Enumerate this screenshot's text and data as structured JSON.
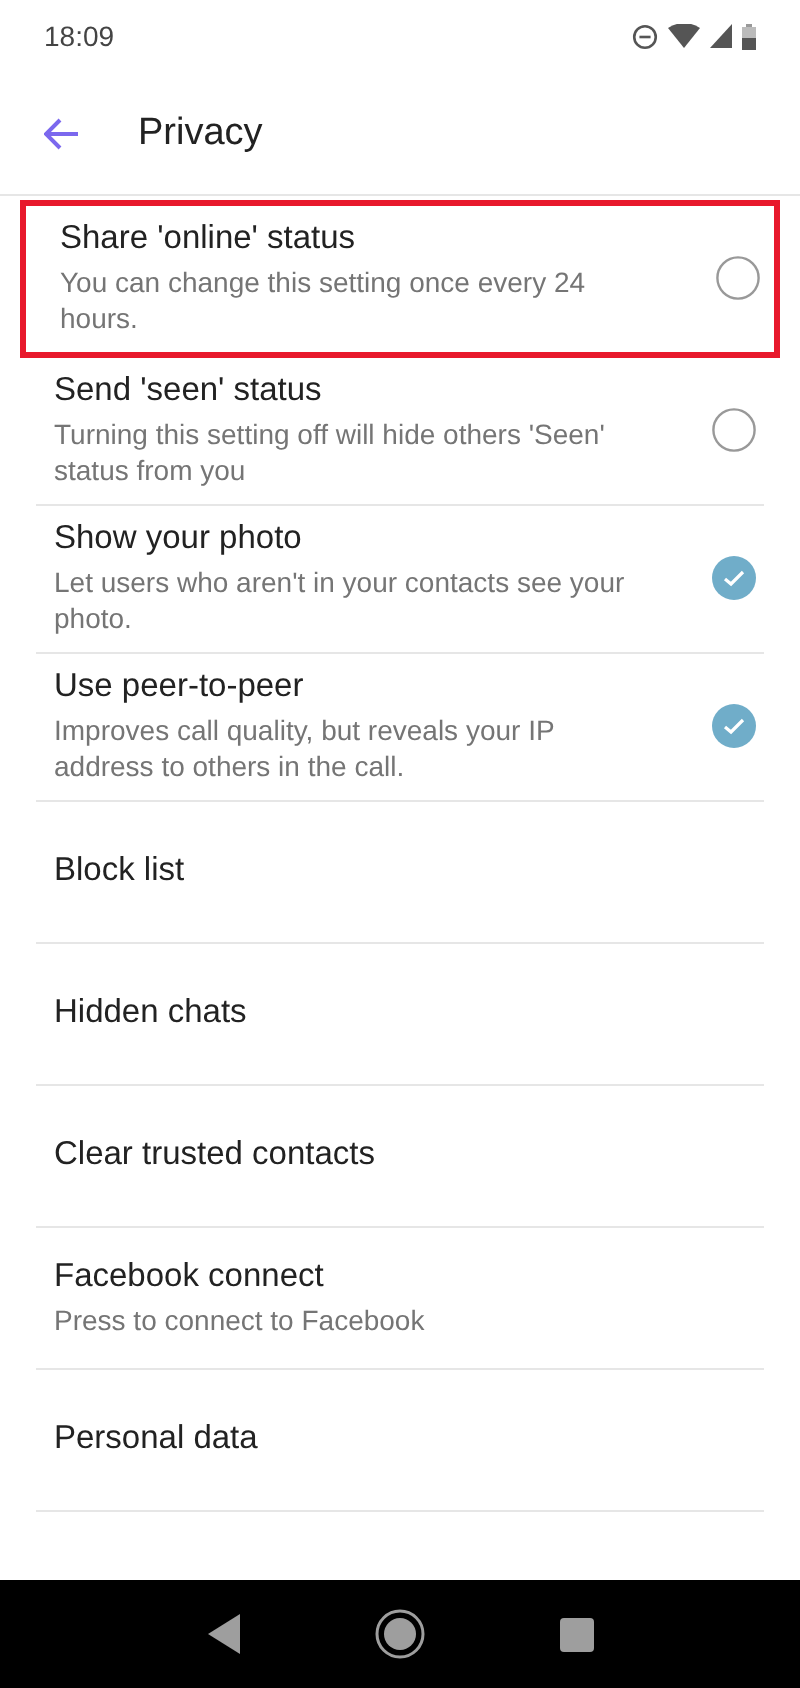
{
  "status_bar": {
    "time": "18:09"
  },
  "header": {
    "title": "Privacy"
  },
  "settings": [
    {
      "kind": "toggle",
      "title": "Share 'online' status",
      "subtitle": "You can change this setting once every 24 hours.",
      "checked": false,
      "highlighted": true
    },
    {
      "kind": "toggle",
      "title": "Send 'seen' status",
      "subtitle": "Turning this setting off will hide others 'Seen' status from you",
      "checked": false,
      "highlighted": false
    },
    {
      "kind": "toggle",
      "title": "Show your photo",
      "subtitle": "Let users who aren't in your contacts see your photo.",
      "checked": true,
      "highlighted": false
    },
    {
      "kind": "toggle",
      "title": "Use peer-to-peer",
      "subtitle": "Improves call quality, but reveals your IP address to others in the call.",
      "checked": true,
      "highlighted": false
    },
    {
      "kind": "link",
      "title": "Block list"
    },
    {
      "kind": "link",
      "title": "Hidden chats"
    },
    {
      "kind": "link",
      "title": "Clear trusted contacts"
    },
    {
      "kind": "link",
      "title": "Facebook connect",
      "subtitle": "Press to connect to Facebook"
    },
    {
      "kind": "link",
      "title": "Personal data"
    }
  ]
}
